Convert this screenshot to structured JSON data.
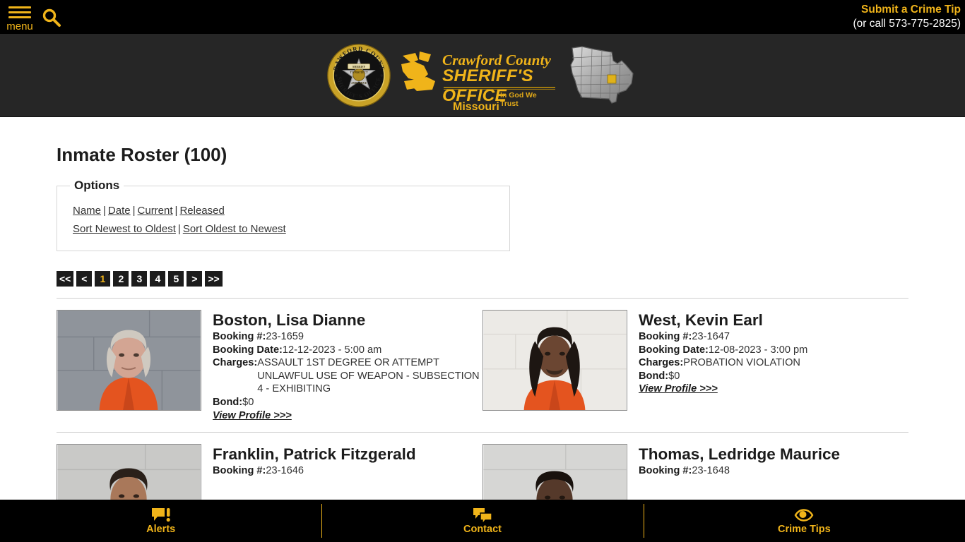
{
  "topbar": {
    "menu_label": "menu",
    "menu_icon": "hamburger-icon",
    "search_icon": "search-icon",
    "crime_tip": "Submit a Crime Tip",
    "crime_phone": "(or call 573-775-2825)"
  },
  "logo": {
    "seal_icon": "sheriff-badge-seal",
    "line1": "Crawford County",
    "line2": "SHERIFF'S OFFICE",
    "motto": "In God We Trust",
    "state": "Missouri",
    "map_icon": "missouri-state-map",
    "gold": "#f0b41a"
  },
  "page": {
    "title": "Inmate Roster (100)"
  },
  "options": {
    "legend": "Options",
    "filters": [
      "Name",
      "Date",
      "Current",
      "Released"
    ],
    "sorts": [
      "Sort Newest to Oldest",
      "Sort Oldest to Newest"
    ],
    "separator": "|"
  },
  "pagination": {
    "first": "<<",
    "prev": "<",
    "pages": [
      "1",
      "2",
      "3",
      "4",
      "5"
    ],
    "next": ">",
    "last": ">>",
    "active": "1"
  },
  "labels": {
    "booking_no": "Booking #:",
    "booking_date": "Booking Date:",
    "charges": "Charges:",
    "bond": "Bond:",
    "view_profile": "View Profile >>>"
  },
  "inmates": [
    {
      "name": "Boston, Lisa Dianne",
      "booking_no": "23-1659",
      "booking_date": "12-12-2023 - 5:00 am",
      "charges": [
        "ASSAULT 1ST DEGREE OR ATTEMPT",
        "UNLAWFUL USE OF WEAPON - SUBSECTION 4 - EXHIBITING"
      ],
      "bond": "$0",
      "photo": "mugshot-boston-lisa-dianne"
    },
    {
      "name": "West, Kevin Earl",
      "booking_no": "23-1647",
      "booking_date": "12-08-2023 - 3:00 pm",
      "charges": [
        "PROBATION VIOLATION"
      ],
      "bond": "$0",
      "photo": "mugshot-west-kevin-earl"
    },
    {
      "name": "Franklin, Patrick Fitzgerald",
      "booking_no": "23-1646",
      "photo": "mugshot-franklin-patrick-fitzgerald"
    },
    {
      "name": "Thomas, Ledridge Maurice",
      "booking_no": "23-1648",
      "photo": "mugshot-thomas-ledridge-maurice"
    }
  ],
  "footer": {
    "items": [
      {
        "label": "Alerts",
        "icon": "alert-bubble-icon"
      },
      {
        "label": "Contact",
        "icon": "chat-bubbles-icon"
      },
      {
        "label": "Crime Tips",
        "icon": "eye-icon"
      }
    ]
  }
}
